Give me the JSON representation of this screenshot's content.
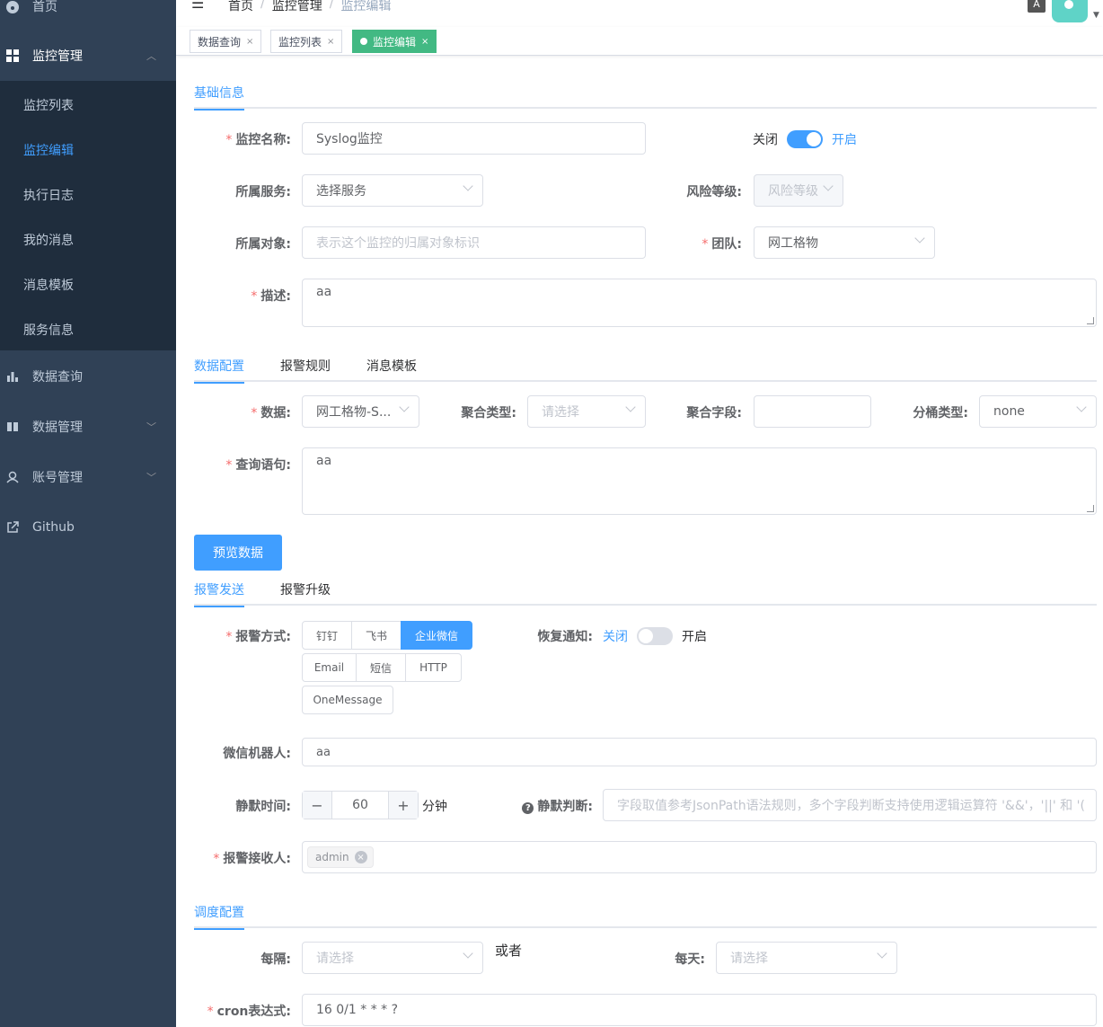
{
  "sidebar": {
    "home": "首页",
    "monitor_mgmt": "监控管理",
    "sub_items": [
      "监控列表",
      "监控编辑",
      "执行日志",
      "我的消息",
      "消息模板",
      "服务信息"
    ],
    "data_query": "数据查询",
    "data_mgmt": "数据管理",
    "account_mgmt": "账号管理",
    "github": "Github"
  },
  "header": {
    "breadcrumb": [
      "首页",
      "监控管理",
      "监控编辑"
    ],
    "lang_label": "A"
  },
  "tags": [
    {
      "label": "数据查询",
      "active": false
    },
    {
      "label": "监控列表",
      "active": false
    },
    {
      "label": "监控编辑",
      "active": true
    }
  ],
  "basic": {
    "tab": "基础信息",
    "name_label": "监控名称:",
    "name_value": "Syslog监控",
    "switch_off": "关闭",
    "switch_on": "开启",
    "service_label": "所属服务:",
    "service_value": "选择服务",
    "risk_label": "风险等级:",
    "risk_placeholder": "风险等级",
    "object_label": "所属对象:",
    "object_placeholder": "表示这个监控的归属对象标识",
    "team_label": "团队:",
    "team_value": "网工格物",
    "desc_label": "描述:",
    "desc_value": "aa"
  },
  "data_config": {
    "tabs": [
      "数据配置",
      "报警规则",
      "消息模板"
    ],
    "data_label": "数据:",
    "data_value": "网工格物-S...",
    "agg_type_label": "聚合类型:",
    "agg_type_placeholder": "请选择",
    "agg_field_label": "聚合字段:",
    "bucket_label": "分桶类型:",
    "bucket_value": "none",
    "query_label": "查询语句:",
    "query_value": "aa",
    "preview_button": "预览数据"
  },
  "alert": {
    "tabs": [
      "报警发送",
      "报警升级"
    ],
    "method_label": "报警方式:",
    "methods_row1": [
      "钉钉",
      "飞书",
      "企业微信"
    ],
    "methods_row2": [
      "Email",
      "短信",
      "HTTP"
    ],
    "methods_row3": [
      "OneMessage"
    ],
    "active_method": "企业微信",
    "recover_label": "恢复通知:",
    "recover_off": "关闭",
    "recover_on": "开启",
    "bot_label": "微信机器人:",
    "bot_value": "aa",
    "silence_label": "静默时间:",
    "silence_value": "60",
    "silence_unit": "分钟",
    "silence_judge_label": "静默判断:",
    "silence_judge_placeholder": "字段取值参考JsonPath语法规则，多个字段判断支持使用逻辑运算符 '&&'，'||' 和 '(",
    "receiver_label": "报警接收人:",
    "receivers": [
      "admin"
    ]
  },
  "schedule": {
    "tab": "调度配置",
    "every_label": "每隔:",
    "every_placeholder": "请选择",
    "or_text": "或者",
    "daily_label": "每天:",
    "daily_placeholder": "请选择",
    "cron_label": "cron表达式:",
    "cron_value": "16 0/1 * * * ?"
  }
}
